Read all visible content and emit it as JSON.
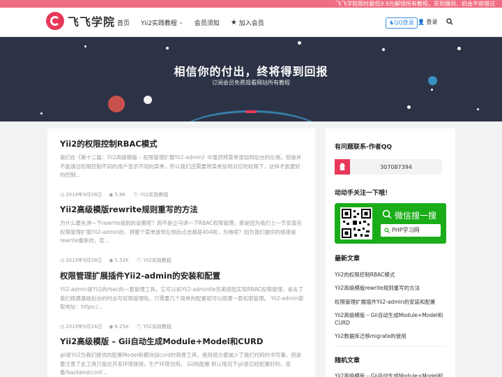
{
  "topbar": {
    "notice": "飞飞学院限时最低9.9元解锁所有教程，买到赚到，机会不容错过"
  },
  "header": {
    "logo_text": "飞飞学院",
    "nav": [
      {
        "label": "首页"
      },
      {
        "label": "Yii2实践教程",
        "has_dropdown": true
      },
      {
        "label": "会员须知"
      },
      {
        "label": "加入会员"
      }
    ],
    "qq_login": "QQ登录",
    "login": "登录",
    "icons": {
      "star": "star-icon",
      "search": "search-icon",
      "user": "user-icon"
    }
  },
  "hero": {
    "title": "相信你的付出，终将得到回报",
    "subtitle": "订阅会员免费观看网站所有教程"
  },
  "posts": [
    {
      "title": "Yii2的权限控制RBAC模式",
      "excerpt": "我们在《第十二篇：Yii2高级模版 – 权限管理扩展Yii2-admin》中虽然将菜单添加到后台的左侧，但是并不能通过权限控制不同的用户显示不同的菜单，所以我们还需要将菜单加到对应的权限下，这样才能更好的控制...",
      "date": "2019年9月28日",
      "views": "5.8K",
      "category": "Yii2实践教程"
    },
    {
      "title": "Yii2高级模版rewrite规则重写的方法",
      "excerpt": "为什么要先讲一下rewrite规则的设置呢？而不是立马讲一下RBAC权限管理，那是因为我们上一节安装完权限管理扩展Yii2-admin后，将整个菜单放到左侧后点击都是404啦，为啥呢？因为我们提供的链接是rewrite重新的，若...",
      "date": "2019年9月28日",
      "views": "5.52K",
      "category": "Yii2实践教程"
    },
    {
      "title": "权限管理扩展插件Yii2-admin的安装和配置",
      "excerpt": "Yii2-admin是Yii2的rbac的一套管理工具，它可以和Yii2-adminlte完美搭配实现RBAC权限管理。省去了我们搭建基础后台的时去写权限管理啦，只需要几个简单的配置就可以搭建一套权限管理。 Yii2-admin获取地址：https:/...",
      "date": "2019年9月24日",
      "views": "6.25K",
      "category": "Yii2实践教程"
    },
    {
      "title": "Yii2高级模版 – Gii自动生成Module+Model和CURD",
      "excerpt": "gii是Yii2为我们提供的配置Model和模块加curd的简易工具，使用很方便减少了我们代码的书写量，但是要注意了此工具只能在开发环境使用，生产环境勿用。 Gii的配置 默认情况下gii是已经配置好的，查看/backend/conf...",
      "date": "",
      "views": "",
      "category": ""
    }
  ],
  "sidebar": {
    "contact_title": "有问题联系-作者QQ",
    "qq_number": "307087394",
    "follow_title": "动动手关注一下哦！",
    "wechat_title": "微信搜一搜",
    "wechat_search": "PHP学习网",
    "latest_title": "最新文章",
    "latest": [
      "Yii2的权限控制RBAC模式",
      "Yii2高级模版rewrite规则重写的方法",
      "权限管理扩展插件Yii2-admin的安装和配置",
      "Yii2高级模版 – Gii自动生成Module+Model和CURD",
      "Yii2数据库迁移migrate的使用"
    ],
    "random_title": "随机文章",
    "random": [
      "Yii2高级模版 – Gii自动生成Module+Model和"
    ]
  },
  "colors": {
    "accent": "#e8385a",
    "hero_bg": "#2d3346",
    "wechat": "#1aad19",
    "qq": "#3a8ee6"
  }
}
